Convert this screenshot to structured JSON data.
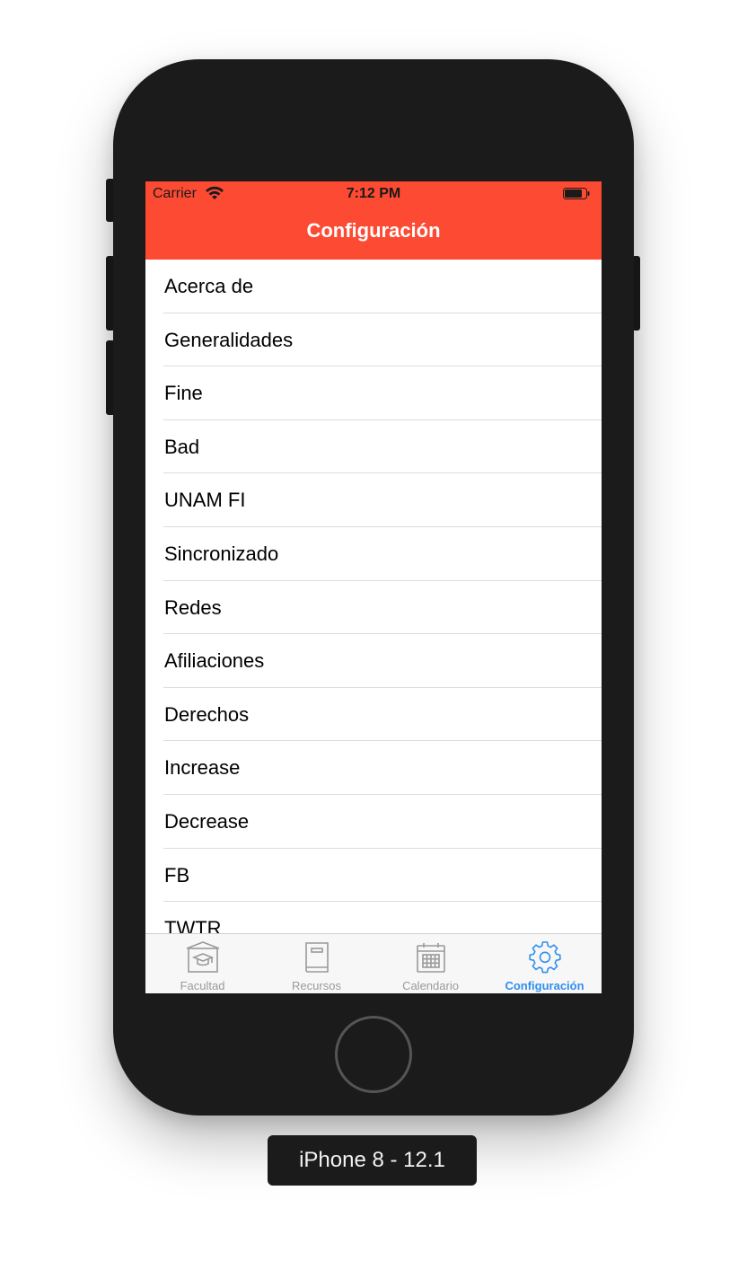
{
  "status_bar": {
    "carrier": "Carrier",
    "time": "7:12 PM",
    "wifi_icon": "wifi-icon",
    "battery_icon": "battery-icon"
  },
  "navbar": {
    "title": "Configuración",
    "color": "#fd4a33"
  },
  "list": {
    "items": [
      "Acerca de",
      "Generalidades",
      "Fine",
      "Bad",
      "UNAM FI",
      "Sincronizado",
      "Redes",
      "Afiliaciones",
      "Derechos",
      "Increase",
      "Decrease",
      "FB",
      "TWTR"
    ]
  },
  "tabbar": {
    "tabs": [
      {
        "label": "Facultad",
        "icon": "school-building-icon",
        "active": false
      },
      {
        "label": "Recursos",
        "icon": "book-icon",
        "active": false
      },
      {
        "label": "Calendario",
        "icon": "calendar-icon",
        "active": false
      },
      {
        "label": "Configuración",
        "icon": "gear-icon",
        "active": true
      }
    ],
    "active_color": "#2f8ff0",
    "inactive_color": "#9a9a9a"
  },
  "device": {
    "label": "iPhone 8 - 12.1"
  }
}
